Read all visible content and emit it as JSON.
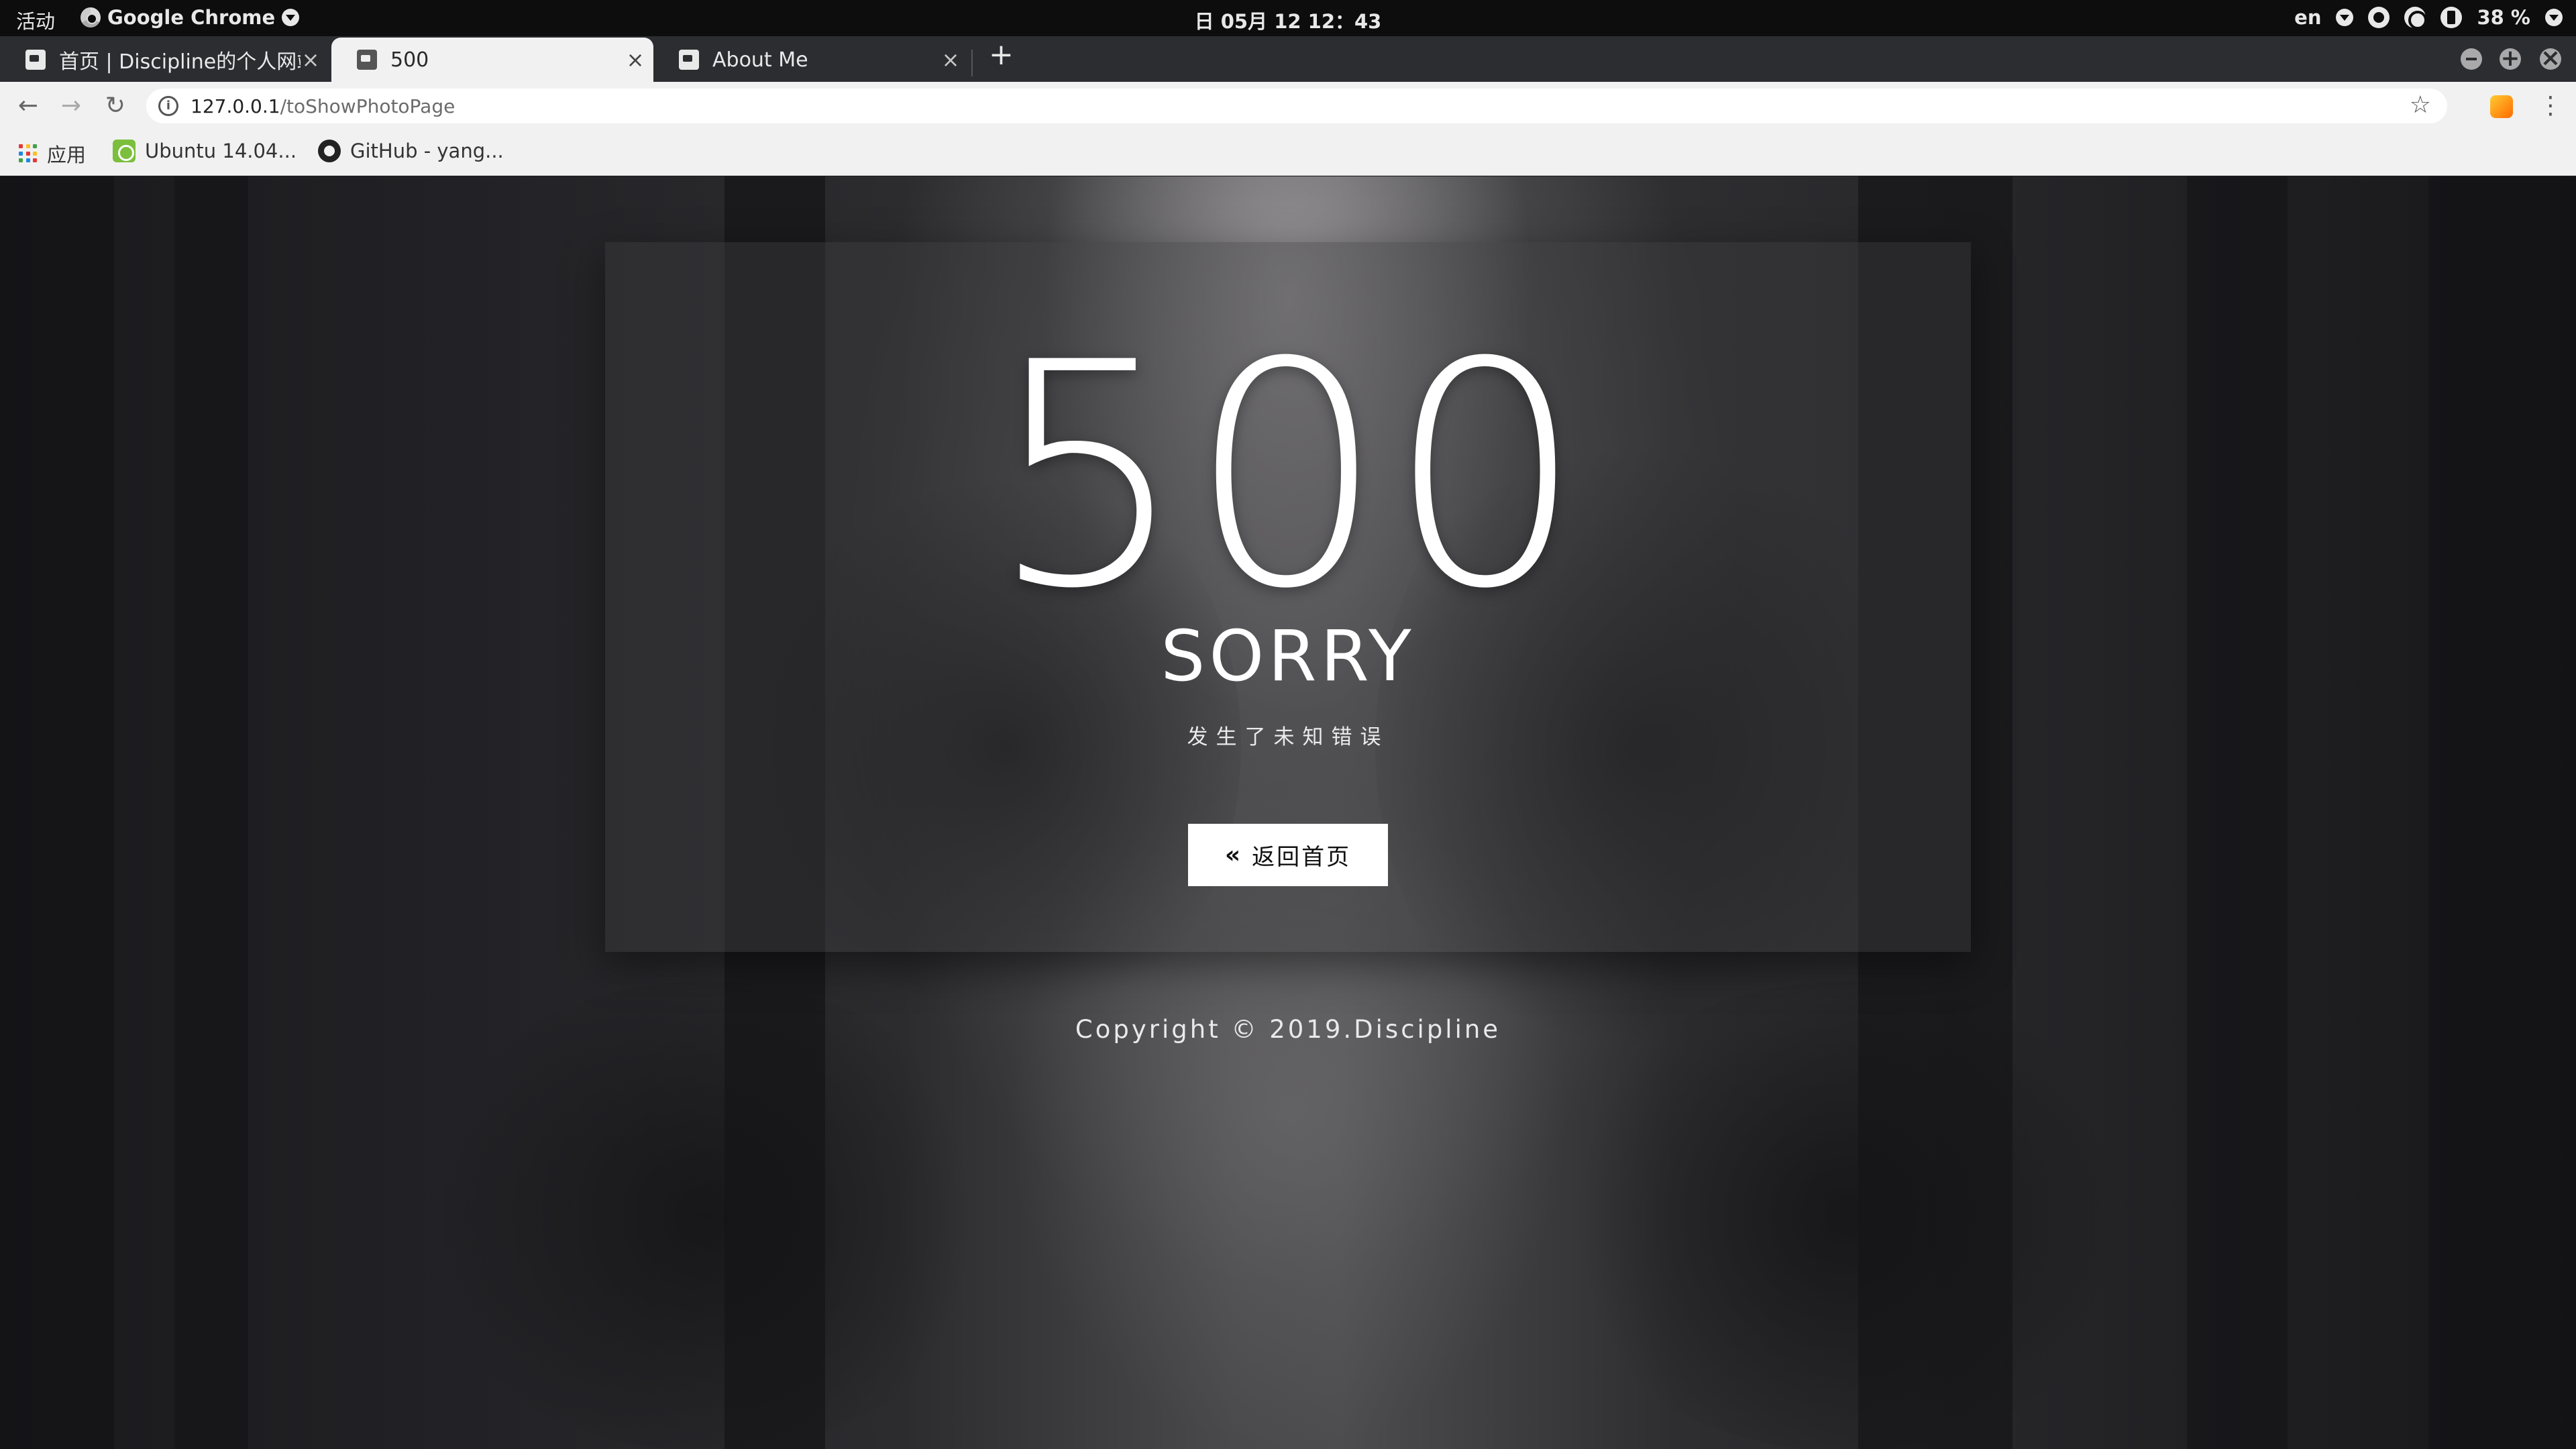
{
  "system_bar": {
    "activities": "活动",
    "app_name": "Google Chrome",
    "clock": "日 05月 12  12：43",
    "input_method": "en",
    "battery": "38 %"
  },
  "tabs": [
    {
      "title": "首页 | Discipline的个人网站",
      "active": false
    },
    {
      "title": "500",
      "active": true
    },
    {
      "title": "About Me",
      "active": false
    }
  ],
  "tab_close_glyph": "×",
  "new_tab_glyph": "+",
  "toolbar": {
    "url_host": "127.0.0.1",
    "url_path": "/toShowPhotoPage"
  },
  "bookmarks": [
    {
      "label": "应用",
      "icon": "apps-grid-icon"
    },
    {
      "label": "Ubuntu 14.04...",
      "icon": "ubuntu-bookmark-icon"
    },
    {
      "label": "GitHub - yang...",
      "icon": "github-icon"
    }
  ],
  "error_page": {
    "code": "500",
    "headline": "SORRY",
    "message": "发生了未知错误",
    "button_icon": "«",
    "button_label": "返回首页",
    "copyright": "Copyright © 2019.Discipline"
  },
  "colors": {
    "tabstrip_bg": "#2b2d31",
    "toolbar_bg": "#f1f1f2",
    "card_overlay": "rgba(60,60,62,0.42)",
    "button_bg": "#ffffff"
  }
}
